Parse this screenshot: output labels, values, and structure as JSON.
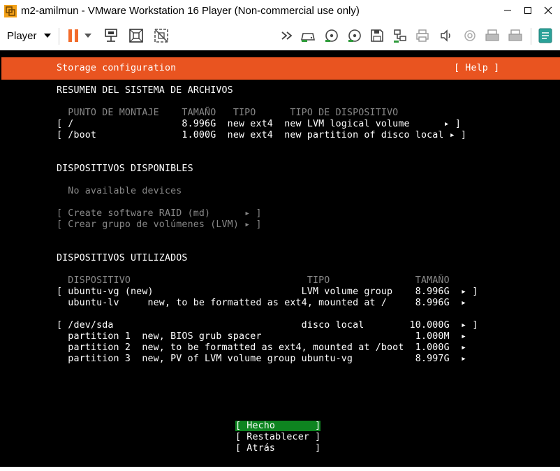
{
  "window": {
    "title": "m2-amilmun - VMware Workstation 16 Player (Non-commercial use only)",
    "controls": {
      "minimize": "—",
      "maximize": "☐",
      "close": "✕"
    }
  },
  "toolbar": {
    "player_label": "Player",
    "icons": [
      "pause-icon",
      "dropdown-caret-icon",
      "send-ctrl-alt-del-icon",
      "fit-guest-icon",
      "unity-icon",
      "forward-icon",
      "hard-disk-icon",
      "cd-dvd-icon",
      "cd-dvd-2-icon",
      "floppy-icon",
      "network-adapter-icon",
      "printer-icon",
      "sound-icon",
      "camera-icon",
      "usb-device-icon",
      "usb-device-2-icon",
      "message-log-icon"
    ]
  },
  "installer": {
    "header_title": "Storage configuration",
    "help": "[ Help ]",
    "summary_title": "RESUMEN DEL SISTEMA DE ARCHIVOS",
    "summary_columns": "  PUNTO DE MONTAJE    TAMAÑO   TIPO      TIPO DE DISPOSITIVO",
    "summary_rows": [
      "[ /                   8.996G  new ext4  new LVM logical volume      ▸ ]",
      "[ /boot               1.000G  new ext4  new partition of disco local ▸ ]"
    ],
    "available_title": "DISPOSITIVOS DISPONIBLES",
    "no_devices": "  No available devices",
    "create_raid": "[ Create software RAID (md)      ▸ ]",
    "create_lvm": "[ Crear grupo de volúmenes (LVM) ▸ ]",
    "used_title": "DISPOSITIVOS UTILIZADOS",
    "used_columns": "  DISPOSITIVO                               TIPO               TAMAÑO",
    "used_rows": [
      "[ ubuntu-vg (new)                          LVM volume group    8.996G  ▸ ]",
      "  ubuntu-lv     new, to be formatted as ext4, mounted at /     8.996G  ▸",
      "[ /dev/sda                                 disco local        10.000G  ▸ ]",
      "  partition 1  new, BIOS grub spacer                           1.000M  ▸",
      "  partition 2  new, to be formatted as ext4, mounted at /boot  1.000G  ▸",
      "  partition 3  new, PV of LVM volume group ubuntu-vg           8.997G  ▸"
    ],
    "buttons": {
      "done": "[ Hecho       ]",
      "reset": "[ Restablecer ]",
      "back": "[ Atrás       ]"
    }
  },
  "colors": {
    "header": "#e95420",
    "selected_button": "#0e8420",
    "screen_bg": "#000000",
    "pause_icon": "#f26b2a"
  }
}
